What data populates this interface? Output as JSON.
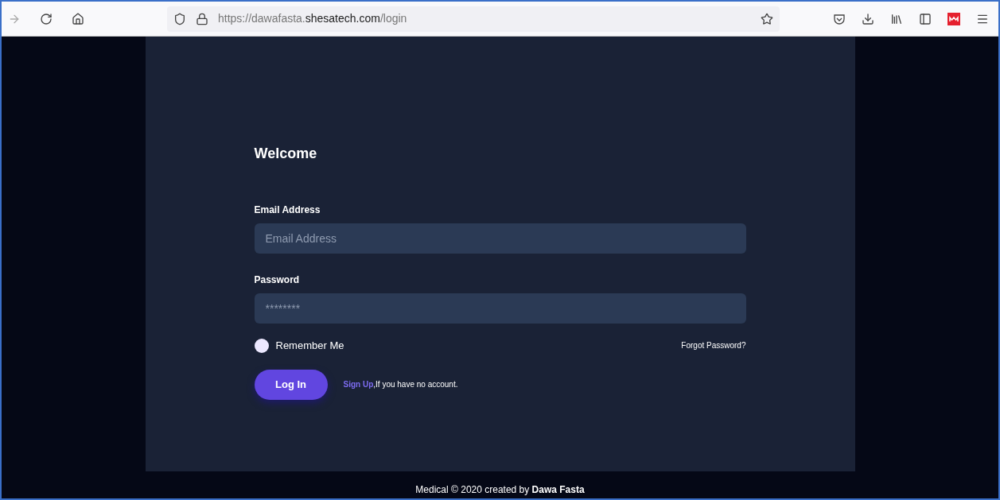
{
  "browser": {
    "url_scheme": "https://dawafasta.",
    "url_domain": "shesatech.com",
    "url_path": "/login"
  },
  "form": {
    "title": "Welcome",
    "fields": [
      {
        "label": "Email Address",
        "placeholder": "Email Address"
      },
      {
        "label": "Password",
        "placeholder": "********"
      }
    ],
    "remember": {
      "label": "Remember Me",
      "checked": false
    },
    "forgot_link": "Forgot Password?",
    "login_button": "Log In",
    "signup_link": "Sign Up",
    "signup_text": ",If you have no account."
  },
  "footer": "Medical © 2020 created by **Dawa Fasta**"
}
